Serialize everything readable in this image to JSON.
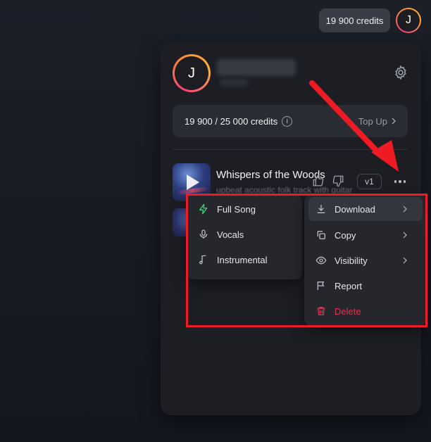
{
  "topbar": {
    "credits_pill": "19 900 credits",
    "avatar_initial": "J"
  },
  "panel": {
    "avatar_initial": "J",
    "credits": {
      "text": "19 900 / 25 000 credits",
      "info_glyph": "i",
      "topup_label": "Top Up"
    },
    "song": {
      "title": "Whispers of the Woods",
      "description": "upbeat acoustic folk track with guitar",
      "version": "v1"
    }
  },
  "download_submenu": {
    "items": [
      {
        "label": "Full Song",
        "icon": "bolt-icon",
        "color": "#3ecf6e"
      },
      {
        "label": "Vocals",
        "icon": "microphone-icon"
      },
      {
        "label": "Instrumental",
        "icon": "music-note-icon"
      }
    ]
  },
  "song_menu": {
    "items": [
      {
        "label": "Download",
        "icon": "download-icon",
        "has_submenu": true,
        "highlighted": true
      },
      {
        "label": "Copy",
        "icon": "copy-icon",
        "has_submenu": true
      },
      {
        "label": "Visibility",
        "icon": "eye-icon",
        "has_submenu": true
      },
      {
        "label": "Report",
        "icon": "flag-icon"
      },
      {
        "label": "Delete",
        "icon": "trash-icon",
        "color": "#e0334f"
      }
    ]
  },
  "colors": {
    "accent_gradient": [
      "#ff3d7f",
      "#ff8a2a"
    ],
    "annotation": "#ee1b24",
    "danger": "#e0334f"
  }
}
